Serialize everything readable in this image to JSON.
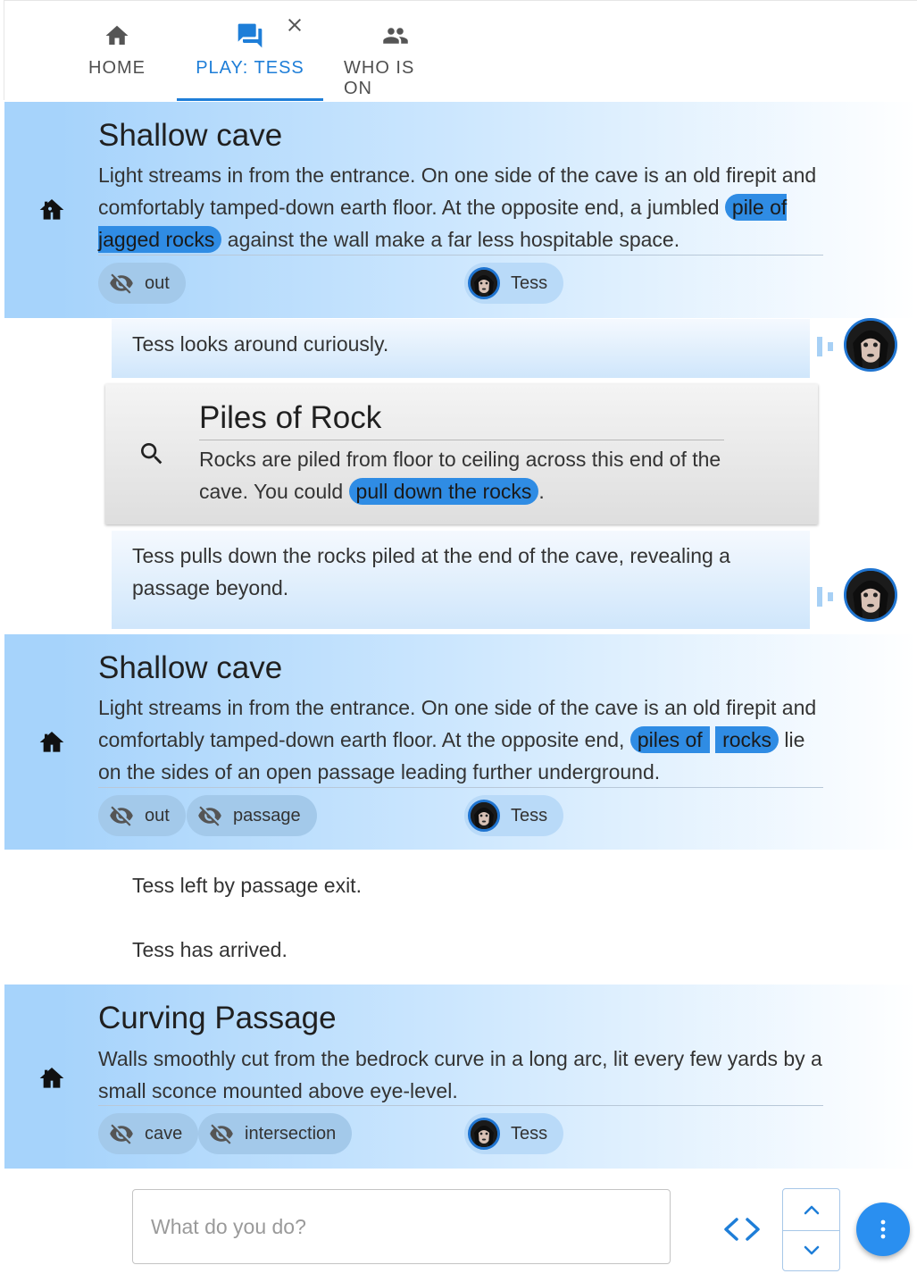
{
  "tabs": [
    {
      "label": "HOME",
      "icon": "home-icon"
    },
    {
      "label": "PLAY: TESS",
      "icon": "forum-icon",
      "active": true
    },
    {
      "label": "WHO IS ON",
      "icon": "people-icon"
    }
  ],
  "colors": {
    "accent": "#1e7ed8",
    "highlight": "#2f8ce4",
    "chip": "#a3c9ea",
    "fab": "#2a8ff0"
  },
  "rooms": [
    {
      "title": "Shallow cave",
      "desc_before": "Light streams in from the entrance. On one side of the cave is an old firepit and comfortably tamped-down earth floor. At the opposite end, a jumbled ",
      "desc_link": "pile of jagged rocks",
      "desc_after": " against the wall make a far less hospitable space.",
      "exits": [
        "out"
      ],
      "character": "Tess"
    },
    {
      "title": "Shallow cave",
      "desc_before": "Light streams in from the entrance. On one side of the cave is an old firepit and comfortably tamped-down earth floor. At the opposite end, ",
      "desc_link_a": "piles of",
      "desc_link_b": "rocks",
      "desc_after": " lie on the sides of an open passage leading further underground.",
      "exits": [
        "out",
        "passage"
      ],
      "character": "Tess"
    },
    {
      "title": "Curving Passage",
      "desc": "Walls smoothly cut from the bedrock curve in a long arc, lit every few yards by a small sconce mounted above eye-level.",
      "exits": [
        "cave",
        "intersection"
      ],
      "character": "Tess"
    }
  ],
  "messages": {
    "look": "Tess looks around curiously.",
    "pull": "Tess pulls down the rocks piled at the end of the cave, revealing a passage beyond.",
    "left": "Tess left by passage exit.",
    "arrived": "Tess has arrived."
  },
  "feature": {
    "title": "Piles of Rock",
    "desc_before": "Rocks are piled from floor to ceiling across this end of the cave. You could ",
    "desc_link": "pull down the rocks",
    "desc_after": "."
  },
  "input": {
    "placeholder": "What do you do?"
  }
}
